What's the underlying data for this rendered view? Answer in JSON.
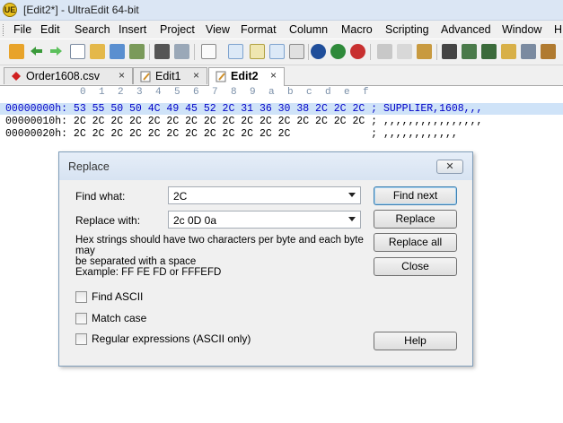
{
  "window": {
    "title": "[Edit2*] - UltraEdit 64-bit",
    "app_icon_text": "UE"
  },
  "menu": [
    "File",
    "Edit",
    "Search",
    "Insert",
    "Project",
    "View",
    "Format",
    "Column",
    "Macro",
    "Scripting",
    "Advanced",
    "Window",
    "H"
  ],
  "tabs": [
    {
      "label": "Order1608.csv",
      "close": "×"
    },
    {
      "label": "Edit1",
      "close": "×"
    },
    {
      "label": "Edit2",
      "close": "×"
    }
  ],
  "ruler": [
    "0",
    "1",
    "2",
    "3",
    "4",
    "5",
    "6",
    "7",
    "8",
    "9",
    "a",
    "b",
    "c",
    "d",
    "e",
    "f"
  ],
  "hex_lines": [
    "00000000h: 53 55 50 50 4C 49 45 52 2C 31 36 30 38 2C 2C 2C ; SUPPLIER,1608,,,",
    "00000010h: 2C 2C 2C 2C 2C 2C 2C 2C 2C 2C 2C 2C 2C 2C 2C 2C ; ,,,,,,,,,,,,,,,,",
    "00000020h: 2C 2C 2C 2C 2C 2C 2C 2C 2C 2C 2C 2C             ; ,,,,,,,,,,,,"
  ],
  "dialog": {
    "title": "Replace",
    "close": "✕",
    "find_label": "Find what:",
    "find_value": "2C",
    "replace_label": "Replace with:",
    "replace_value": "2c 0D 0a",
    "hint_line1": "Hex strings should have two characters per byte and each byte may",
    "hint_line2": "be separated with a space",
    "hint_line3": "Example: FF FE FD or FFFEFD",
    "find_ascii": "Find ASCII",
    "match_case": "Match case",
    "regex": "Regular expressions (ASCII only)",
    "btn_find_next": "Find next",
    "btn_replace": "Replace",
    "btn_replace_all": "Replace all",
    "btn_close": "Close",
    "btn_help": "Help"
  },
  "colors": {
    "selection": "#cfe3f8",
    "hex_text": "#0000c8",
    "ruler": "#7a8fa8"
  }
}
